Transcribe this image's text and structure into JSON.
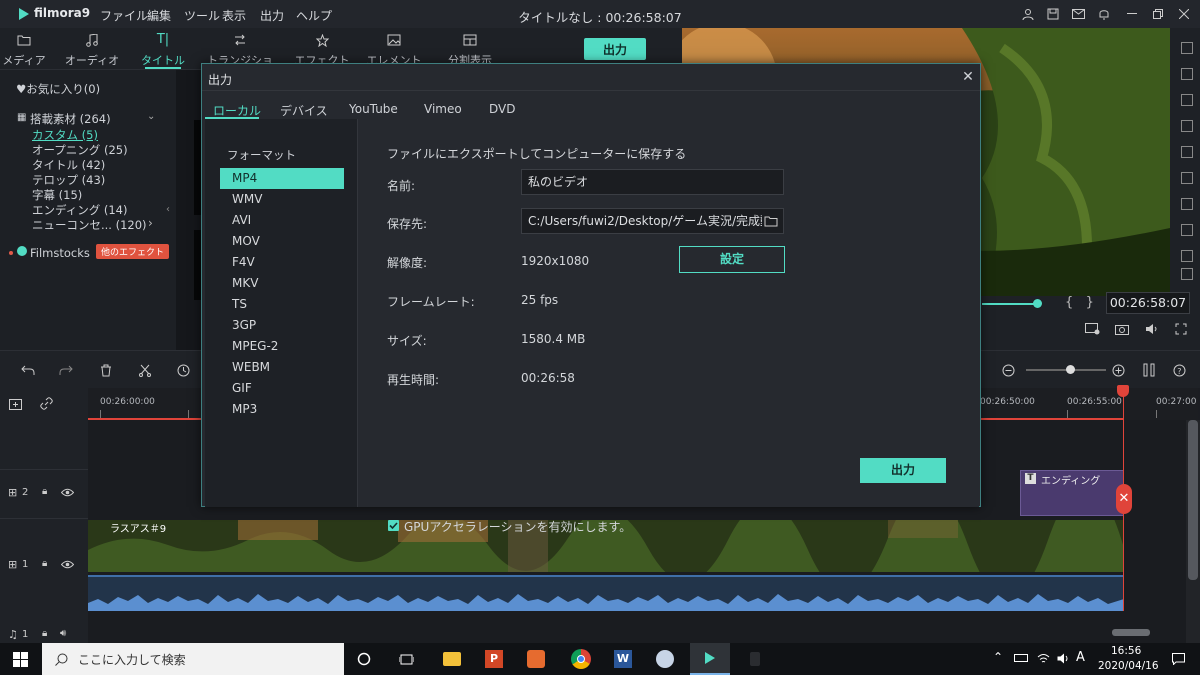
{
  "app": {
    "name": "filmora9",
    "window_title": "タイトルなし : 00:26:58:07"
  },
  "menu": [
    "ファイル",
    "編集",
    "ツール",
    "表示",
    "出力",
    "ヘルプ"
  ],
  "toolbar": {
    "tabs": [
      "メディア",
      "オーディオ",
      "タイトル",
      "トランジション",
      "エフェクト",
      "エレメント",
      "分割表示"
    ],
    "export_label": "出力"
  },
  "library": {
    "favorites": "♥お気に入り(0)",
    "builtin": "搭載素材 (264)",
    "categories": [
      "カスタム (5)",
      "オープニング (25)",
      "タイトル (42)",
      "テロップ (43)",
      "字幕 (15)",
      "エンディング (14)",
      "ニューコンセ... (120)"
    ],
    "filmstocks": "Filmstocks",
    "more_effects_badge": "他のエフェクト"
  },
  "dialog": {
    "title": "出力",
    "tabs": [
      "ローカル",
      "デバイス",
      "YouTube",
      "Vimeo",
      "DVD"
    ],
    "format_header": "フォーマット",
    "formats": [
      "MP4",
      "WMV",
      "AVI",
      "MOV",
      "F4V",
      "MKV",
      "TS",
      "3GP",
      "MPEG-2",
      "WEBM",
      "GIF",
      "MP3"
    ],
    "selected_format": "MP4",
    "description": "ファイルにエクスポートしてコンピューターに保存する",
    "name_label": "名前:",
    "name_value": "私のビデオ",
    "save_to_label": "保存先:",
    "save_to_value": "C:/Users/fuwi2/Desktop/ゲーム実況/完成動",
    "resolution_label": "解像度:",
    "resolution_value": "1920x1080",
    "settings_button": "設定",
    "framerate_label": "フレームレート:",
    "framerate_value": "25 fps",
    "size_label": "サイズ:",
    "size_value": "1580.4 MB",
    "duration_label": "再生時間:",
    "duration_value": "00:26:58",
    "gpu_label": "GPUアクセラレーションを有効にします。",
    "gpu_checked": true,
    "export_button": "出力",
    "accent_color": "#52dcc4"
  },
  "preview": {
    "timecode": "00:26:58:07",
    "bracket_symbols": "{   }"
  },
  "timeline": {
    "ruler": [
      "00:26:00:00",
      "00:26:50:00",
      "00:26:55:00",
      "00:27:00"
    ],
    "clips": {
      "ending_title": "エンディング",
      "video": "ラスアス＃9"
    },
    "tracks": [
      "2",
      "1",
      "1"
    ]
  },
  "taskbar": {
    "search_placeholder": "ここに入力して検索",
    "time": "16:56",
    "date": "2020/04/16",
    "ime": "A"
  }
}
